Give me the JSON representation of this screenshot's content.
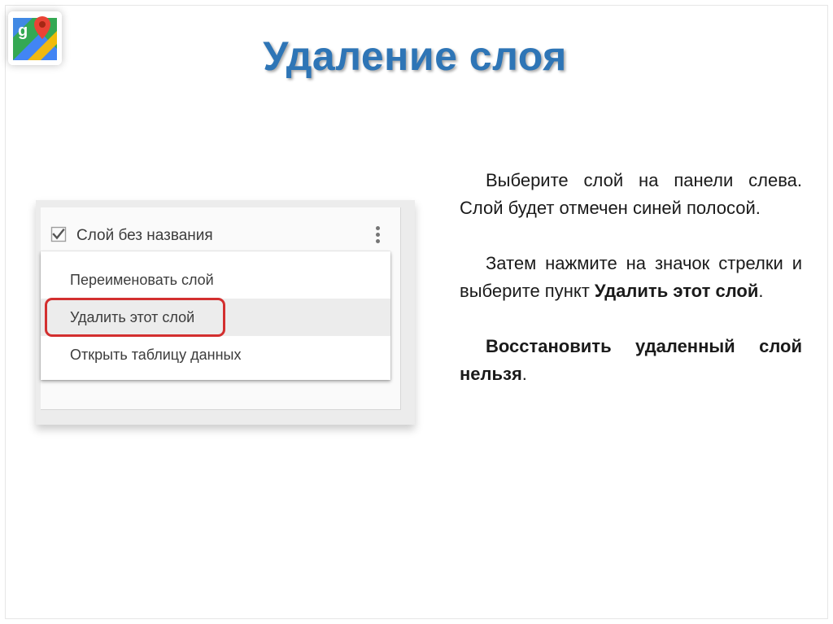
{
  "slide": {
    "title": "Удаление слоя",
    "logo_icon": "google-my-maps-icon",
    "logo_letter": "g"
  },
  "panel": {
    "layer": {
      "checked": true,
      "name": "Слой без названия",
      "checkbox_icon": "checkmark-icon",
      "menu_icon": "more-vert-icon"
    },
    "menu_items": [
      {
        "label": "Переименовать слой",
        "highlighted": false
      },
      {
        "label": "Удалить этот слой",
        "highlighted": true
      },
      {
        "label": "Открыть таблицу данных",
        "highlighted": false
      }
    ],
    "highlight_color": "#d32f2f"
  },
  "instructions": {
    "p1": "Выберите слой на панели слева. Слой будет отмечен синей полосой.",
    "p2_prefix": "Затем нажмите на значок стрелки и выберите пункт ",
    "p2_bold": "Удалить этот слой",
    "p2_suffix": ".",
    "p3_bold": "Восстановить удаленный слой нельзя",
    "p3_suffix": "."
  },
  "colors": {
    "title": "#2e75b6",
    "text": "#1a1a1a"
  }
}
